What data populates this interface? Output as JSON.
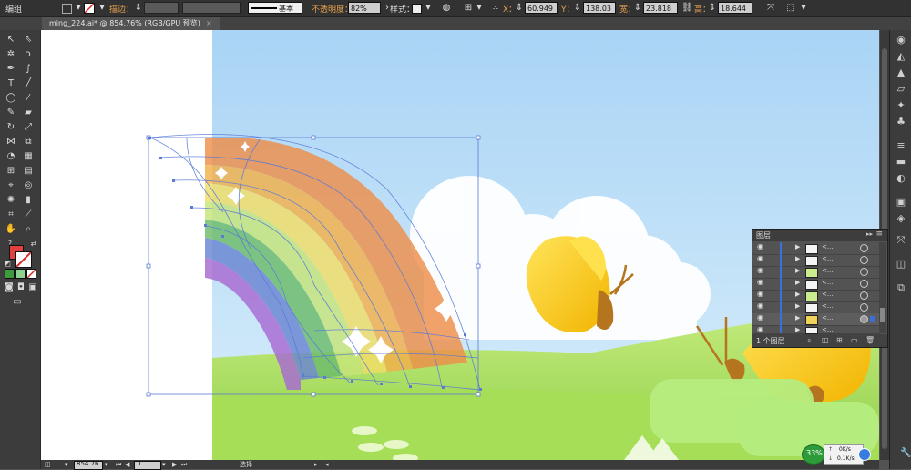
{
  "control_bar": {
    "mode_label": "编组",
    "stroke_label": "描边：",
    "stroke_weight_label": "基本",
    "opacity_label": "不透明度：",
    "opacity_value": "82%",
    "style_label": "样式：",
    "x_label": "X：",
    "x_value": "60.949 m",
    "y_label": "Y：",
    "y_value": "138.03 m",
    "w_label": "宽：",
    "w_value": "23.818 m",
    "h_label": "高：",
    "h_value": "18.644 m"
  },
  "document_tab": {
    "title": "ming_224.ai* @ 854.76% (RGB/GPU 预览)",
    "close": "×"
  },
  "layers_panel": {
    "title": "图层",
    "collapse_icon": "▸▸",
    "menu_icon": "≡",
    "layer_count": "1 个图层",
    "rows": [
      {
        "name": "<..."
      },
      {
        "name": "<..."
      },
      {
        "name": "<..."
      },
      {
        "name": "<..."
      },
      {
        "name": "<..."
      },
      {
        "name": "<..."
      },
      {
        "name": "<..."
      },
      {
        "name": "<..."
      }
    ]
  },
  "status_bar": {
    "zoom": "854.76",
    "page": "1",
    "tool_name": "选择"
  },
  "net_widget": {
    "percent": "33%",
    "upload": "0K/s",
    "download": "0.1K/s"
  },
  "colors": {
    "app_bg": "#535353",
    "panel_dark": "#323232",
    "accent_orange": "#e8a04d",
    "selection_blue": "#5a7ad8",
    "fill_red": "#d42a2a",
    "net_green": "#2d9b3a"
  }
}
